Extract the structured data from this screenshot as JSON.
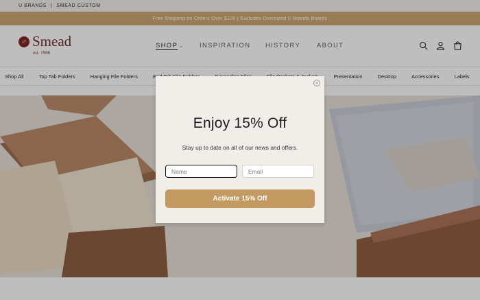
{
  "topbar": {
    "brand1": "U BRANDS",
    "separator": "|",
    "brand2": "SMEAD CUSTOM"
  },
  "promo": {
    "text": "Free Shipping on Orders Over $100 | Excludes Oversized U Brands Boards"
  },
  "logo": {
    "mark": "///",
    "word": "Smead",
    "est": "est. 1906"
  },
  "nav": {
    "shop": "SHOP",
    "inspiration": "INSPIRATION",
    "history": "HISTORY",
    "about": "ABOUT"
  },
  "header_icons": [
    "search-icon",
    "account-icon",
    "cart-icon"
  ],
  "subnav": {
    "items": [
      "Shop All",
      "Top Tab Folders",
      "Hanging File Folders",
      "End Tab File Folders",
      "Expanding Files",
      "File Pockets & Jackets",
      "Presentation",
      "Desktop",
      "Accessories",
      "Labels"
    ]
  },
  "modal": {
    "close": "×",
    "title": "Enjoy 15% Off",
    "subtitle": "Stay up to date on all of our news and offers.",
    "name_placeholder": "Name",
    "email_placeholder": "Email",
    "cta": "Activate 15% Off"
  },
  "colors": {
    "promo_bg": "#c9a46e",
    "cta_bg": "#c39a62",
    "brand": "#6b2a2a",
    "modal_bg": "#f1eeea"
  }
}
